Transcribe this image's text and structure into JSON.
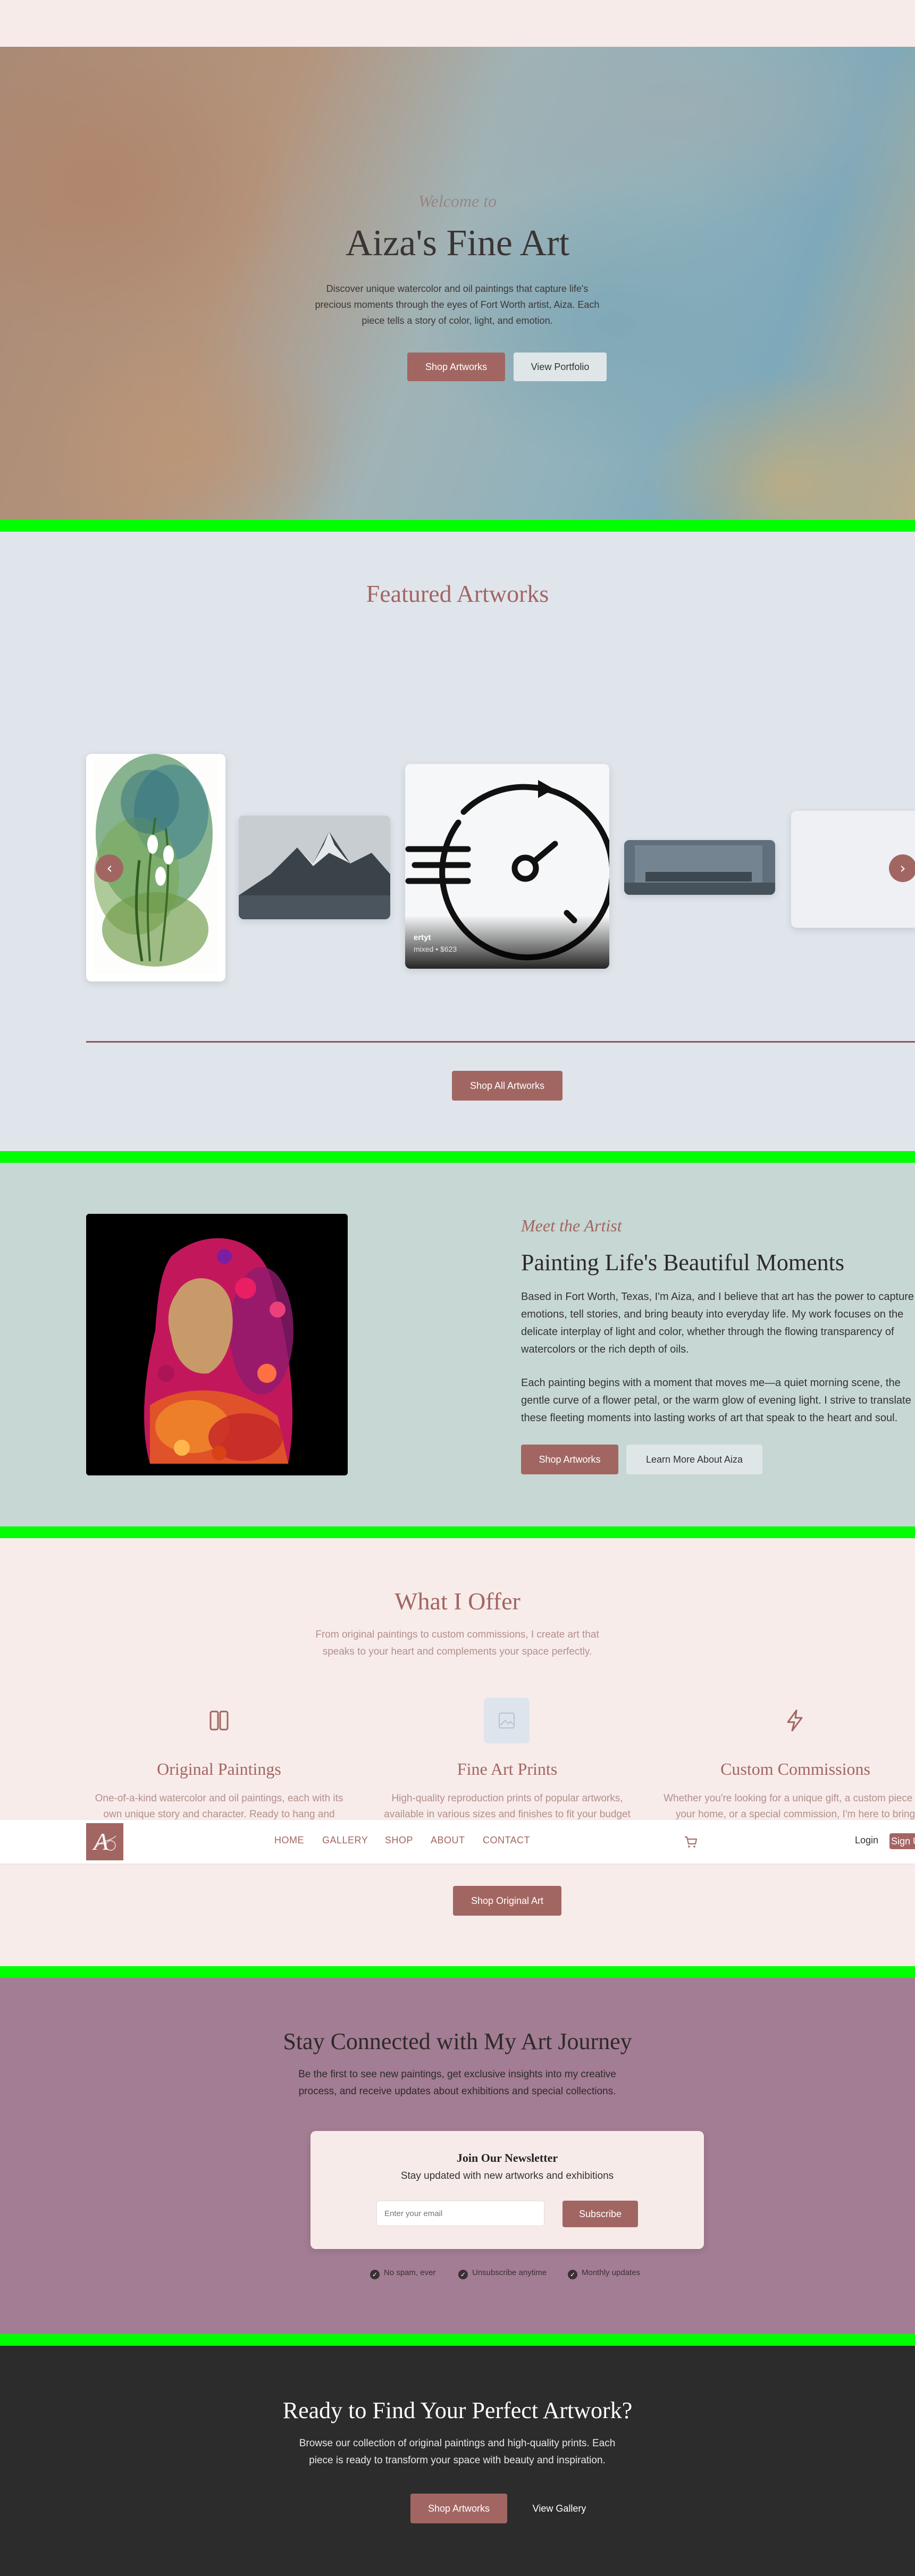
{
  "hero": {
    "eyebrow": "Welcome to",
    "title": "Aiza's Fine Art",
    "description": "Discover unique watercolor and oil paintings that capture life's precious moments through the eyes of Fort Worth artist, Aiza. Each piece tells a story of color, light, and emotion.",
    "shop_button": "Shop Artworks",
    "portfolio_button": "View Portfolio"
  },
  "featured": {
    "title": "Featured Artworks",
    "center_card": {
      "title": "ertyt",
      "meta": "mixed • $623"
    },
    "prev_arrow": "‹",
    "next_arrow": "›",
    "shop_all_button": "Shop All Artworks"
  },
  "artist": {
    "eyebrow": "Meet the Artist",
    "title": "Painting Life's Beautiful Moments",
    "paragraph_1": "Based in Fort Worth, Texas, I'm Aiza, and I believe that art has the power to capture emotions, tell stories, and bring beauty into everyday life. My work focuses on the delicate interplay of light and color, whether through the flowing transparency of watercolors or the rich depth of oils.",
    "paragraph_2": "Each painting begins with a moment that moves me—a quiet morning scene, the gentle curve of a flower petal, or the warm glow of evening light. I strive to translate these fleeting moments into lasting works of art that speak to the heart and soul.",
    "shop_button": "Shop Artworks",
    "learn_more_button": "Learn More About Aiza"
  },
  "offer": {
    "title": "What I Offer",
    "subtitle": "From original paintings to custom commissions, I create art that speaks to your heart and complements your space perfectly.",
    "items": [
      {
        "title": "Original Paintings",
        "description": "One-of-a-kind watercolor and oil paintings, each with its own unique story and character. Ready to hang and"
      },
      {
        "title": "Fine Art Prints",
        "description": "High-quality reproduction prints of popular artworks, available in various sizes and finishes to fit your budget"
      },
      {
        "title": "Custom Commissions",
        "description": "Whether you're looking for a unique gift, a custom piece for your home, or a special commission, I'm here to bring"
      }
    ],
    "shop_button": "Shop Original Art"
  },
  "nav": {
    "logo_initials": "A",
    "links": [
      "HOME",
      "GALLERY",
      "SHOP",
      "ABOUT",
      "CONTACT"
    ],
    "login": "Login",
    "signup": "Sign Up"
  },
  "newsletter": {
    "title": "Stay Connected with My Art Journey",
    "description": "Be the first to see new paintings, get exclusive insights into my creative process, and receive updates about exhibitions and special collections.",
    "card_title": "Join Our Newsletter",
    "card_subtitle": "Stay updated with new artworks and exhibitions",
    "email_placeholder": "Enter your email",
    "subscribe_button": "Subscribe",
    "perks": [
      "No spam, ever",
      "Unsubscribe anytime",
      "Monthly updates"
    ]
  },
  "cta": {
    "title": "Ready to Find Your Perfect Artwork?",
    "description": "Browse our collection of original paintings and high-quality prints. Each piece is ready to transform your space with beauty and inspiration.",
    "shop_button": "Shop Artworks",
    "gallery_button": "View Gallery"
  },
  "colors": {
    "accent": "#a26662",
    "highlight_bar": "#00ff00",
    "hero_bg": "#f7ecea",
    "featured_bg": "#e0e5ec",
    "artist_bg": "#c7d7d3",
    "newsletter_bg": "#a37d93",
    "cta_bg": "#2c2c2c"
  }
}
